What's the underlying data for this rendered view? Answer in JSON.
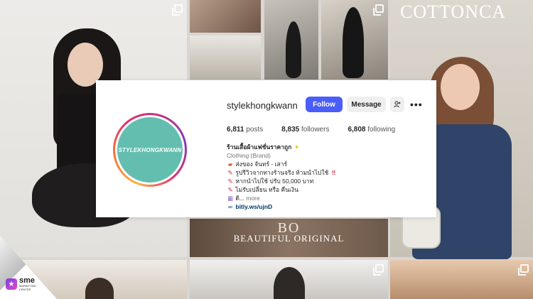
{
  "profile": {
    "username": "stylekhongkwann",
    "avatar_text": "STYLEKHONGKWANN",
    "follow_label": "Follow",
    "message_label": "Message",
    "posts_count": "6,811",
    "posts_label": "posts",
    "followers_count": "8,835",
    "followers_label": "followers",
    "following_count": "6,808",
    "following_label": "following"
  },
  "bio": {
    "name": "ร้านเสื้อผ้าแฟชั่นราคาถูก",
    "category": "Clothing (Brand)",
    "lines": [
      "ส่งของ จันทร์ - เสาร์",
      "รูปรีวิวจากทางร้านจริง ห้ามนำไปใช้",
      "หากนำไปใช้ ปรับ 50,000 บาท",
      "ไม่รับเปลี่ยน หรือ คืนเงิน"
    ],
    "truncated": "ดิ...",
    "more_label": "more",
    "link": "bitly.ws/ujnD"
  },
  "background": {
    "brand_text": "COTTONCA",
    "overlay_top": "BO",
    "overlay_bottom": "BEAUTIFUL ORIGINAL"
  },
  "watermark": {
    "brand": "sme",
    "sub1": "MARKETING",
    "sub2": "CENTER"
  },
  "colors": {
    "follow_button": "#4a5df9",
    "avatar_bg": "#63beb0",
    "link": "#00376b"
  }
}
